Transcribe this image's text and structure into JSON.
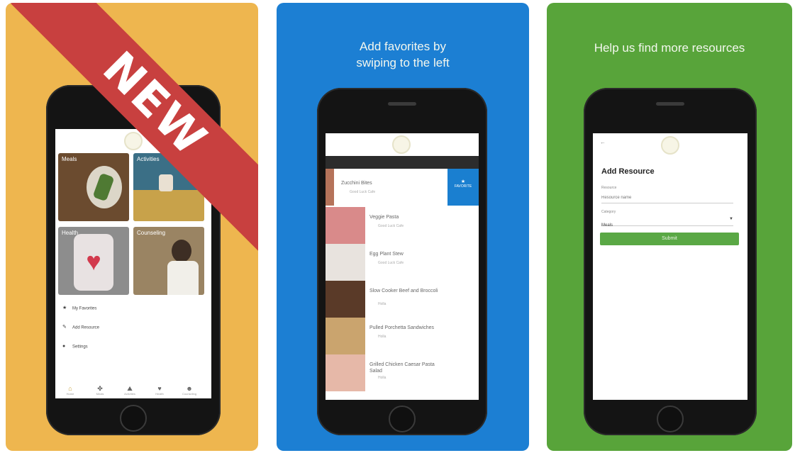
{
  "panel1": {
    "badge_text": "NEW",
    "menu": [
      {
        "icon": "star-icon",
        "label": "My Favorites"
      },
      {
        "icon": "pencil-icon",
        "label": "Add Resource"
      },
      {
        "icon": "gear-icon",
        "label": "Settings"
      }
    ],
    "tiles": [
      {
        "label": "Meals",
        "color": "#6b4b2f"
      },
      {
        "label": "Activities",
        "color": "#3b6f86"
      },
      {
        "label": "Health",
        "color": "#8d8d8d"
      },
      {
        "label": "Counseling",
        "color": "#9a8463"
      }
    ],
    "tabs": [
      {
        "icon": "home-icon",
        "label": "Home"
      },
      {
        "icon": "food-icon",
        "label": "Meals"
      },
      {
        "icon": "activity-icon",
        "label": "Activities"
      },
      {
        "icon": "heart-icon",
        "label": "Health"
      },
      {
        "icon": "counseling-icon",
        "label": "Counseling"
      }
    ]
  },
  "panel2": {
    "caption_line1": "Add favorites by",
    "caption_line2": "swiping to the left",
    "items": [
      {
        "name": "Zucchini Bites",
        "sub": "Good Luck Cafe"
      },
      {
        "name": "Veggie Pasta",
        "sub": "Good Luck Cafe"
      },
      {
        "name": "Egg Plant Stew",
        "sub": "Good Luck Cafe"
      },
      {
        "name": "Slow Cooker Beef and Broccoli",
        "sub": "Holla"
      },
      {
        "name": "Pulled Porchetta Sandwiches",
        "sub": "Holla"
      },
      {
        "name": "Grilled Chicken Caesar Pasta Salad",
        "sub": "Holla"
      }
    ],
    "favorite_label": "FAVORITE"
  },
  "panel3": {
    "caption": "Help us find more resources",
    "form_title": "Add Resource",
    "resource_label": "Resource",
    "resource_placeholder": "Resource name",
    "category_label": "Category",
    "category_value": "Meals",
    "submit_label": "Submit"
  },
  "colors": {
    "panel1_bg": "#eeb64f",
    "panel2_bg": "#1c7fd3",
    "panel3_bg": "#58a43a",
    "ribbon": "#c8403f",
    "submit": "#5aa845"
  }
}
